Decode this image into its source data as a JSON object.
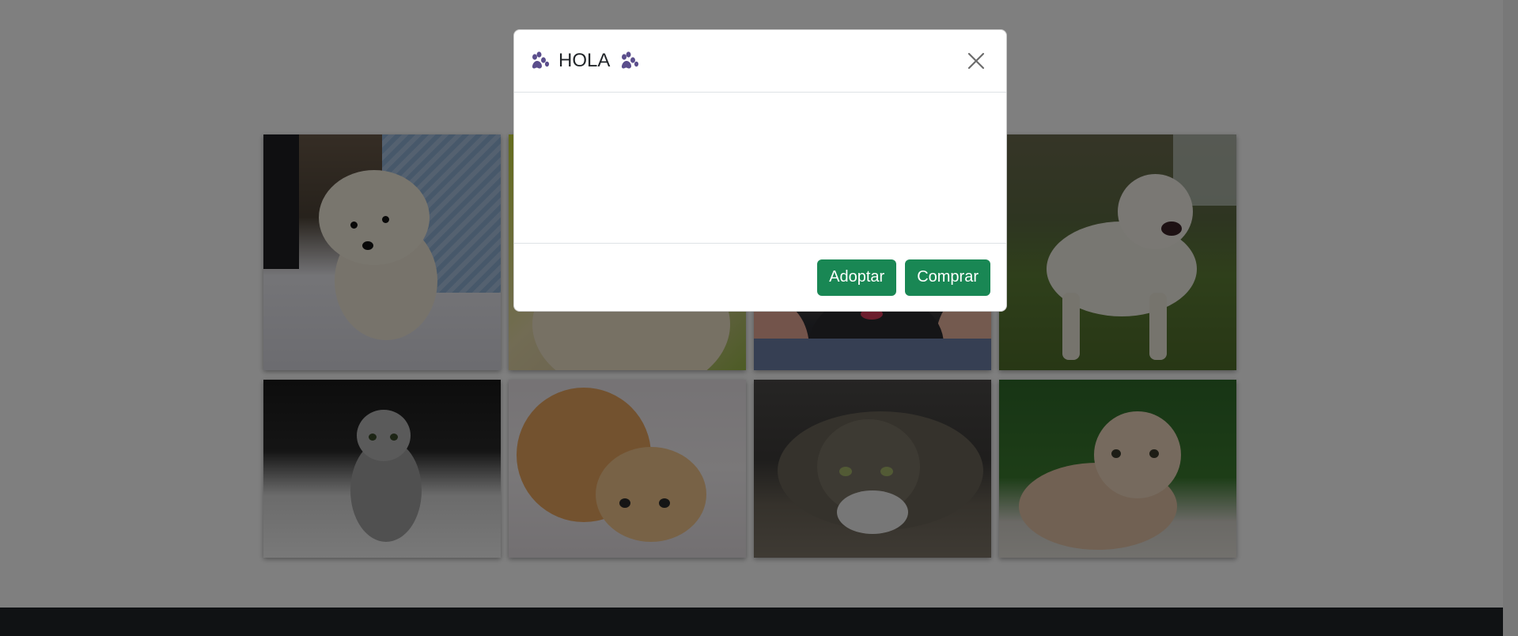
{
  "modal": {
    "title": "HOLA",
    "title_icon": "paw-icon",
    "close_icon": "close-icon",
    "buttons": {
      "adopt_label": "Adoptar",
      "buy_label": "Comprar"
    },
    "button_color": "#198754"
  },
  "gallery": {
    "items": [
      {
        "subject": "puppy"
      },
      {
        "subject": "cat"
      },
      {
        "subject": "dog"
      },
      {
        "subject": "dog"
      },
      {
        "subject": "kitten"
      },
      {
        "subject": "cat"
      },
      {
        "subject": "cat"
      },
      {
        "subject": "kitten"
      }
    ]
  },
  "colors": {
    "paw": "#5b4e8c",
    "footer": "#212529",
    "backdrop": "rgba(0,0,0,0.5)"
  }
}
